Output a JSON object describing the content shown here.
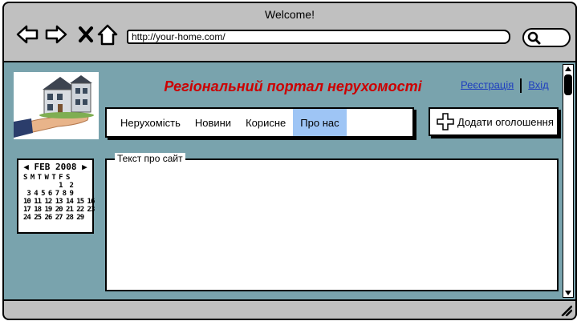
{
  "browser": {
    "title": "Welcome!",
    "url": "http://your-home.com/"
  },
  "site": {
    "title": "Регіональний портал нерухомості",
    "register_link": "Реєстрація",
    "login_link": "Вхід",
    "add_button": "Додати оголошення"
  },
  "menu": {
    "items": [
      {
        "label": "Нерухомість"
      },
      {
        "label": "Новини"
      },
      {
        "label": "Корисне"
      },
      {
        "label": "Про нас"
      }
    ],
    "active": "Про нас"
  },
  "calendar": {
    "month": "FEB 2008",
    "weekdays": "S M T W T F S",
    "rows": [
      "          1  2",
      " 3 4 5 6 7 8 9",
      "10 11 12 13 14 15 16",
      "17 18 19 20 21 22 23",
      "24 25 26 27 28 29"
    ]
  },
  "panel": {
    "label": "Текст про сайт"
  },
  "colors": {
    "background": "#79a3ad",
    "title": "#cc0000",
    "link": "#1f3fbf",
    "active_menu": "#9ec5f5"
  }
}
